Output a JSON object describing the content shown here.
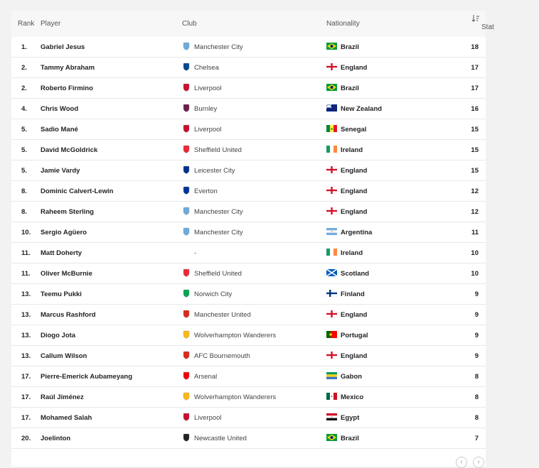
{
  "table": {
    "headers": {
      "rank": "Rank",
      "player": "Player",
      "club": "Club",
      "nationality": "Nationality",
      "stat": "Stat"
    },
    "rows": [
      {
        "rank": "1.",
        "player": "Gabriel Jesus",
        "club": "Manchester City",
        "nationality": "Brazil",
        "stat": "18",
        "club_color": "#6cabdd",
        "flag": "brazil"
      },
      {
        "rank": "2.",
        "player": "Tammy Abraham",
        "club": "Chelsea",
        "nationality": "England",
        "stat": "17",
        "club_color": "#034694",
        "flag": "england"
      },
      {
        "rank": "2.",
        "player": "Roberto Firmino",
        "club": "Liverpool",
        "nationality": "Brazil",
        "stat": "17",
        "club_color": "#c8102e",
        "flag": "brazil"
      },
      {
        "rank": "4.",
        "player": "Chris Wood",
        "club": "Burnley",
        "nationality": "New Zealand",
        "stat": "16",
        "club_color": "#6c1d45",
        "flag": "newzealand"
      },
      {
        "rank": "5.",
        "player": "Sadio Mané",
        "club": "Liverpool",
        "nationality": "Senegal",
        "stat": "15",
        "club_color": "#c8102e",
        "flag": "senegal"
      },
      {
        "rank": "5.",
        "player": "David McGoldrick",
        "club": "Sheffield United",
        "nationality": "Ireland",
        "stat": "15",
        "club_color": "#ee2737",
        "flag": "ireland"
      },
      {
        "rank": "5.",
        "player": "Jamie Vardy",
        "club": "Leicester City",
        "nationality": "England",
        "stat": "15",
        "club_color": "#003090",
        "flag": "england"
      },
      {
        "rank": "8.",
        "player": "Dominic Calvert-Lewin",
        "club": "Everton",
        "nationality": "England",
        "stat": "12",
        "club_color": "#003399",
        "flag": "england"
      },
      {
        "rank": "8.",
        "player": "Raheem Sterling",
        "club": "Manchester City",
        "nationality": "England",
        "stat": "12",
        "club_color": "#6cabdd",
        "flag": "england"
      },
      {
        "rank": "10.",
        "player": "Sergio Agüero",
        "club": "Manchester City",
        "nationality": "Argentina",
        "stat": "11",
        "club_color": "#6cabdd",
        "flag": "argentina"
      },
      {
        "rank": "11.",
        "player": "Matt Doherty",
        "club": "-",
        "nationality": "Ireland",
        "stat": "10",
        "club_color": "",
        "flag": "ireland"
      },
      {
        "rank": "11.",
        "player": "Oliver McBurnie",
        "club": "Sheffield United",
        "nationality": "Scotland",
        "stat": "10",
        "club_color": "#ee2737",
        "flag": "scotland"
      },
      {
        "rank": "13.",
        "player": "Teemu Pukki",
        "club": "Norwich City",
        "nationality": "Finland",
        "stat": "9",
        "club_color": "#00a650",
        "flag": "finland"
      },
      {
        "rank": "13.",
        "player": "Marcus Rashford",
        "club": "Manchester United",
        "nationality": "England",
        "stat": "9",
        "club_color": "#da291c",
        "flag": "england"
      },
      {
        "rank": "13.",
        "player": "Diogo Jota",
        "club": "Wolverhampton Wanderers",
        "nationality": "Portugal",
        "stat": "9",
        "club_color": "#fdb913",
        "flag": "portugal"
      },
      {
        "rank": "13.",
        "player": "Callum Wilson",
        "club": "AFC Bournemouth",
        "nationality": "England",
        "stat": "9",
        "club_color": "#da291c",
        "flag": "england"
      },
      {
        "rank": "17.",
        "player": "Pierre-Emerick Aubameyang",
        "club": "Arsenal",
        "nationality": "Gabon",
        "stat": "8",
        "club_color": "#ef0107",
        "flag": "gabon"
      },
      {
        "rank": "17.",
        "player": "Raúl Jiménez",
        "club": "Wolverhampton Wanderers",
        "nationality": "Mexico",
        "stat": "8",
        "club_color": "#fdb913",
        "flag": "mexico"
      },
      {
        "rank": "17.",
        "player": "Mohamed Salah",
        "club": "Liverpool",
        "nationality": "Egypt",
        "stat": "8",
        "club_color": "#c8102e",
        "flag": "egypt"
      },
      {
        "rank": "20.",
        "player": "Joelinton",
        "club": "Newcastle United",
        "nationality": "Brazil",
        "stat": "7",
        "club_color": "#241f20",
        "flag": "brazil"
      }
    ]
  },
  "pagination": {
    "prev_icon": "chevron-left-icon",
    "next_icon": "chevron-right-icon"
  }
}
